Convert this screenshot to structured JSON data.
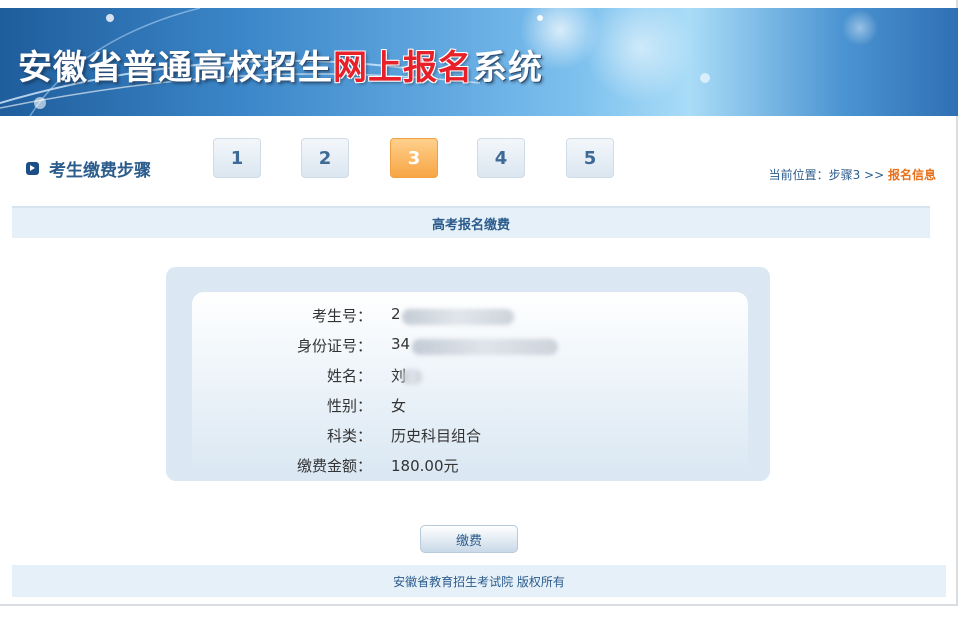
{
  "header": {
    "title_part1": "安徽省普通高校招生",
    "title_highlight": "网上报名",
    "title_part2": "系统"
  },
  "steps": {
    "label": "考生缴费步骤",
    "items": [
      "1",
      "2",
      "3",
      "4",
      "5"
    ],
    "active_index": 2,
    "location_prefix": "当前位置：步骤3 >> ",
    "location_current": "报名信息"
  },
  "section": {
    "title": "高考报名缴费"
  },
  "info": {
    "rows": [
      {
        "label": "考生号：",
        "value": "2"
      },
      {
        "label": "身份证号：",
        "value": "34"
      },
      {
        "label": "姓名：",
        "value": "刘"
      },
      {
        "label": "性别：",
        "value": "女"
      },
      {
        "label": "科类：",
        "value": "历史科目组合"
      },
      {
        "label": "缴费金额：",
        "value": "180.00元"
      }
    ]
  },
  "actions": {
    "pay_label": "缴费"
  },
  "footer": {
    "copyright": "安徽省教育招生考试院 版权所有"
  },
  "colors": {
    "accent": "#2b5c8c",
    "active_step": "#f7a544",
    "highlight": "#e8202a",
    "location_current": "#e8701a"
  }
}
